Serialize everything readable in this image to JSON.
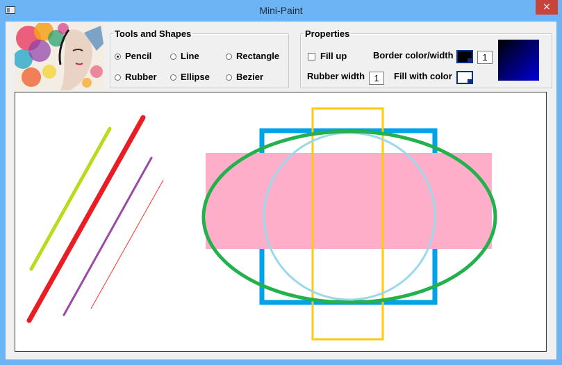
{
  "window": {
    "title": "Mini-Paint",
    "close_glyph": "×"
  },
  "tools_group": {
    "legend": "Tools and Shapes",
    "options": [
      {
        "label": "Pencil",
        "checked": true
      },
      {
        "label": "Line",
        "checked": false
      },
      {
        "label": "Rectangle",
        "checked": false
      },
      {
        "label": "Rubber",
        "checked": false
      },
      {
        "label": "Ellipse",
        "checked": false
      },
      {
        "label": "Bezier",
        "checked": false
      }
    ]
  },
  "properties_group": {
    "legend": "Properties",
    "fill_up_label": "Fill up",
    "fill_up_checked": false,
    "border_color_width_label": "Border color/width",
    "border_color": "#000000",
    "border_width": "1",
    "rubber_width_label": "Rubber width",
    "rubber_width": "1",
    "fill_with_color_label": "Fill with color",
    "fill_color": "#ffffff",
    "gradient_colors": [
      "#000000",
      "#0000d8"
    ]
  },
  "canvas": {
    "background": "#ffffff",
    "shape_colors": {
      "lime_line": "#b7dc1c",
      "red_line": "#ea1c24",
      "purple_line": "#9b49a4",
      "thin_red_line": "#ff3030",
      "blue_rectangle": "#00a2e8",
      "yellow_rectangle": "#ffc90e",
      "pink_fill": "#ffaec9",
      "green_ellipse": "#22b14c",
      "lightblue_circle": "#99d9ea"
    }
  }
}
